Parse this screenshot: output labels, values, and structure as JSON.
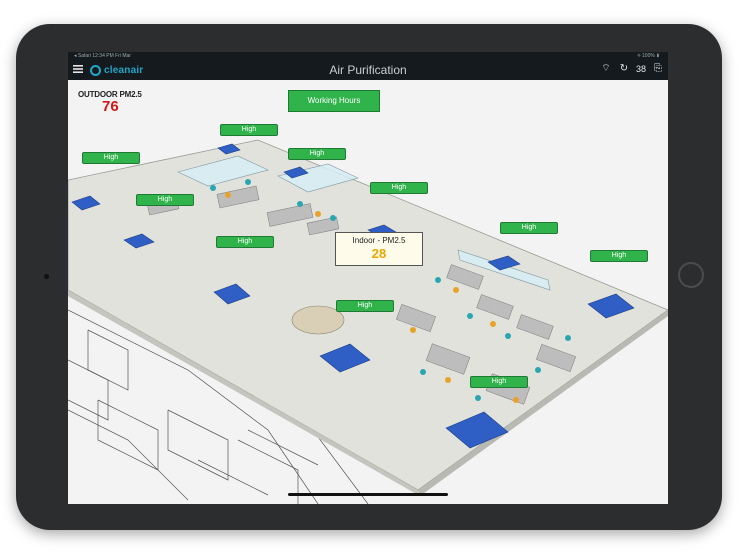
{
  "statusbar": {
    "left_text": "◂ Safari  12:34 PM  Fri Mar",
    "right_text": "⟡ 100% ▮"
  },
  "navbar": {
    "logo_text": "cleanair",
    "title": "Air Purification",
    "count": "38"
  },
  "outdoor": {
    "label": "OUTDOOR PM2.5",
    "value": "76"
  },
  "working_hours": {
    "label": "Working Hours"
  },
  "indoor": {
    "label": "Indoor - PM2.5",
    "value": "28"
  },
  "zones": [
    {
      "label": "High"
    },
    {
      "label": "High"
    },
    {
      "label": "High"
    },
    {
      "label": "High"
    },
    {
      "label": "High"
    },
    {
      "label": "High"
    },
    {
      "label": "High"
    },
    {
      "label": "High"
    },
    {
      "label": "High"
    },
    {
      "label": "High"
    }
  ],
  "colors": {
    "accent": "#2fb34a",
    "outdoor_value": "#d01818",
    "indoor_value": "#e6a800",
    "navbar": "#151a1f",
    "purifier": "#2f5fc4"
  },
  "icons": [
    "menu-icon",
    "wifi-icon",
    "refresh-icon",
    "exit-icon"
  ]
}
